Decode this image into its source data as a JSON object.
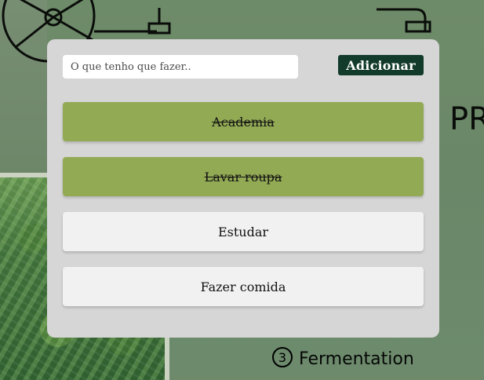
{
  "todo": {
    "input_placeholder": "O que tenho que fazer..",
    "add_label": "Adicionar",
    "tasks": [
      {
        "label": "Academia",
        "done": true
      },
      {
        "label": "Lavar roupa",
        "done": true
      },
      {
        "label": "Estudar",
        "done": false
      },
      {
        "label": "Fazer comida",
        "done": false
      }
    ]
  },
  "background": {
    "sketch_title_partial": "PR",
    "step_label": "Fermentation",
    "step_number": "3"
  },
  "colors": {
    "card_bg": "#d6d6d6",
    "done_task_bg": "#93aa55",
    "open_task_bg": "#f1f1f1",
    "add_button_bg": "#123b2b",
    "add_button_text": "#ffffff"
  }
}
